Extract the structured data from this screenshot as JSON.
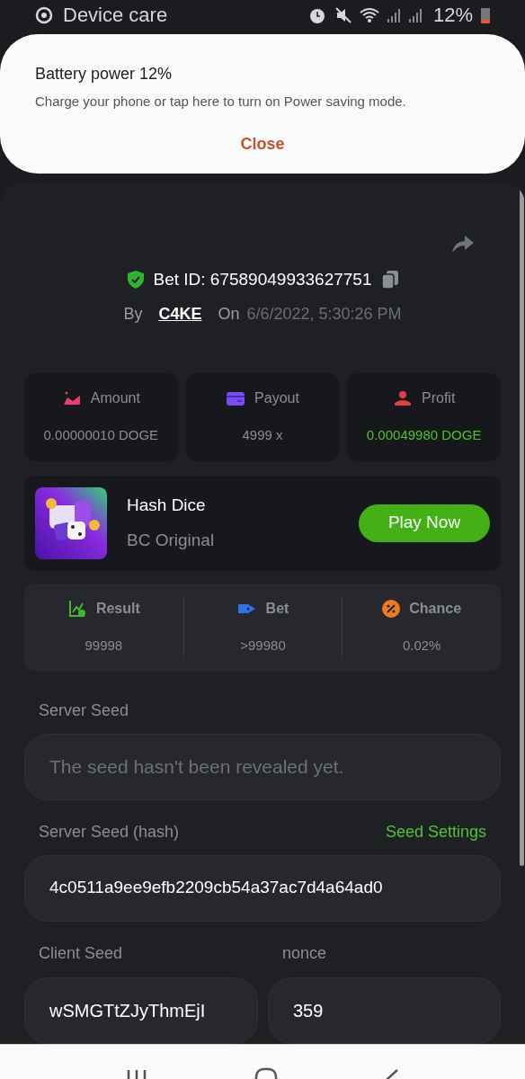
{
  "status_bar": {
    "app_title": "Device care",
    "battery_text": "12%"
  },
  "notification": {
    "title": "Battery power 12%",
    "message": "Charge your phone or tap here to turn on Power saving mode.",
    "action": "Close"
  },
  "bet": {
    "id_text": "Bet ID: 67589049933627751",
    "by_label": "By",
    "user": "C4KE",
    "on_label": "On",
    "date": "6/6/2022, 5:30:26 PM"
  },
  "stats": [
    {
      "kind": "amount",
      "label": "Amount",
      "value": "0.00000010 DOGE",
      "positive": false
    },
    {
      "kind": "payout",
      "label": "Payout",
      "value": "4999 x",
      "positive": false
    },
    {
      "kind": "profit",
      "label": "Profit",
      "value": "0.00049980 DOGE",
      "positive": true
    }
  ],
  "game": {
    "name": "Hash Dice",
    "provider": "BC Original",
    "button": "Play Now"
  },
  "results": [
    {
      "kind": "result",
      "label": "Result",
      "value": "99998"
    },
    {
      "kind": "bet",
      "label": "Bet",
      "value": ">99980"
    },
    {
      "kind": "chance",
      "label": "Chance",
      "value": "0.02%"
    }
  ],
  "server_seed": {
    "label": "Server Seed",
    "placeholder": "The seed hasn't been revealed yet."
  },
  "server_seed_hash": {
    "label": "Server Seed (hash)",
    "link": "Seed Settings",
    "value": "4c0511a9ee9efb2209cb54a37ac7d4a64ad0"
  },
  "client_seed": {
    "label": "Client Seed",
    "value": "wSMGTtZJyThmEjI"
  },
  "nonce": {
    "label": "nonce",
    "value": "359"
  }
}
